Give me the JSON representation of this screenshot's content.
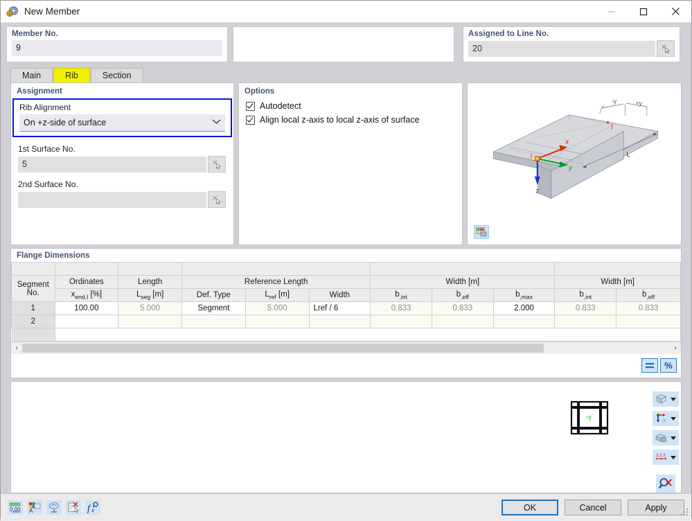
{
  "window": {
    "title": "New Member",
    "icon": "member-icon",
    "minimize": "—",
    "maximize": "☐",
    "close": "✕"
  },
  "top_fields": {
    "member_no": {
      "label": "Member No.",
      "value": "9"
    },
    "assigned_line": {
      "label": "Assigned to Line No.",
      "value": "20",
      "pick_icon": "pick-cursor-icon"
    }
  },
  "tabs": [
    {
      "label": "Main",
      "active": false
    },
    {
      "label": "Rib",
      "active": true
    },
    {
      "label": "Section",
      "active": false
    }
  ],
  "assignment": {
    "title": "Assignment",
    "rib_alignment": {
      "label": "Rib Alignment",
      "value": "On +z-side of surface",
      "chevron": "⌄"
    },
    "first_surface": {
      "label": "1st Surface No.",
      "value": "5"
    },
    "second_surface": {
      "label": "2nd Surface No.",
      "value": ""
    }
  },
  "options": {
    "title": "Options",
    "items": [
      {
        "label": "Autodetect",
        "checked": true
      },
      {
        "label": "Align local z-axis to local z-axis of surface",
        "checked": true
      }
    ]
  },
  "graphic": {
    "axis_x": "x",
    "axis_y": "y",
    "axis_z": "z",
    "node_i": "i",
    "node_j": "j",
    "dim_minus_y": "-y",
    "dim_plus_y": "+y",
    "dim_length": "L",
    "render_button_icon": "render-image-icon"
  },
  "flange": {
    "title": "Flange Dimensions",
    "group_headers": [
      {
        "label": "",
        "span": 1
      },
      {
        "label": "",
        "span": 1
      },
      {
        "label": "",
        "span": 1
      },
      {
        "label": "Reference Length",
        "span": 3
      },
      {
        "label": "Width [m]",
        "span": 3
      },
      {
        "label": "Width [m]",
        "span": 2
      }
    ],
    "columns": [
      {
        "line1": "Segment",
        "line2": "No."
      },
      {
        "line1": "Ordinates",
        "line2": "x",
        "sub": "end,I",
        "unit": " [%]"
      },
      {
        "line1": "Length",
        "line2": "L",
        "sub": "seg",
        "unit": " [m]"
      },
      {
        "line1": "",
        "line2": "Def. Type"
      },
      {
        "line1": "",
        "line2": "L",
        "sub": "ref",
        "unit": " [m]"
      },
      {
        "line1": "",
        "line2": "Width"
      },
      {
        "line1": "",
        "line2": "b",
        "sub": ",int"
      },
      {
        "line1": "",
        "line2": "b",
        "sub": ",eff"
      },
      {
        "line1": "",
        "line2": "b",
        "sub": ",max"
      },
      {
        "line1": "",
        "line2": "b",
        "sub": ",int"
      },
      {
        "line1": "",
        "line2": "b",
        "sub": ",eff"
      }
    ],
    "rows": [
      {
        "segment_no": "1",
        "cells": [
          {
            "value": "100.00",
            "style": "val"
          },
          {
            "value": "5.000",
            "style": "valgray"
          },
          {
            "value": "Segment",
            "style": "val"
          },
          {
            "value": "5.000",
            "style": "valgray"
          },
          {
            "value": "Lref / 6",
            "style": "val"
          },
          {
            "value": "0.833",
            "style": "valgray"
          },
          {
            "value": "0.833",
            "style": "valgray"
          },
          {
            "value": "2.000",
            "style": "val"
          },
          {
            "value": "0.833",
            "style": "valgray"
          },
          {
            "value": "0.833",
            "style": "valgray"
          }
        ]
      },
      {
        "segment_no": "2",
        "cells": [
          {
            "value": "",
            "style": "blank"
          },
          {
            "value": "",
            "style": "blankgray"
          },
          {
            "value": "",
            "style": "blankgray"
          },
          {
            "value": "",
            "style": "blankgray"
          },
          {
            "value": "",
            "style": "blankgray"
          },
          {
            "value": "",
            "style": "blankgray"
          },
          {
            "value": "",
            "style": "blankgray"
          },
          {
            "value": "",
            "style": "blankgray"
          },
          {
            "value": "",
            "style": "blankgray"
          },
          {
            "value": "",
            "style": "blankgray"
          }
        ]
      }
    ],
    "scroll": {
      "left_arrow": "‹",
      "right_arrow": "›"
    },
    "mini_buttons": [
      {
        "label": "≡",
        "name": "equal-button"
      },
      {
        "label": "%",
        "name": "percent-button"
      }
    ]
  },
  "preview": {
    "grid_icon": "section-grid-icon",
    "tools": [
      {
        "icon": "cube-view-icon",
        "dropdown": true
      },
      {
        "icon": "axis-system-icon",
        "dropdown": true
      },
      {
        "icon": "layers-icon",
        "dropdown": true
      },
      {
        "icon": "numbering-icon",
        "dropdown": true
      },
      {
        "icon": "reset-zoom-icon",
        "dropdown": false
      }
    ]
  },
  "bottom": {
    "icons": [
      "units-decimals-icon",
      "display-properties-icon",
      "visual-settings-icon",
      "comment-cut-icon",
      "formula-icon"
    ],
    "buttons": [
      {
        "label": "OK",
        "primary": true
      },
      {
        "label": "Cancel",
        "primary": false
      },
      {
        "label": "Apply",
        "primary": false
      }
    ]
  },
  "colors": {
    "accent_blue": "#1010ee",
    "tab_active": "#f2f200",
    "panel_label": "#44546f",
    "button_focus": "#1574c8"
  }
}
